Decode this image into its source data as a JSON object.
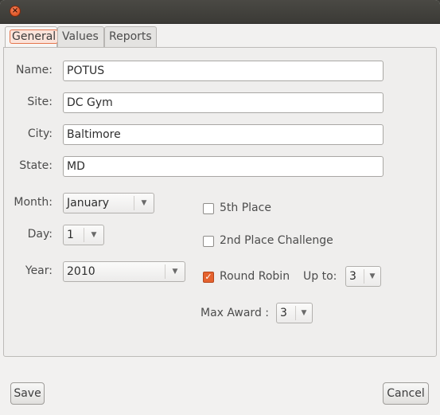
{
  "titlebar": {
    "close_glyph": "×"
  },
  "tabs": [
    {
      "label": "General"
    },
    {
      "label": "Values"
    },
    {
      "label": "Reports"
    }
  ],
  "general": {
    "name": {
      "label": "Name:",
      "value": "POTUS"
    },
    "site": {
      "label": "Site:",
      "value": "DC Gym"
    },
    "city": {
      "label": "City:",
      "value": "Baltimore"
    },
    "state": {
      "label": "State:",
      "value": "MD"
    },
    "month": {
      "label": "Month:",
      "value": "January"
    },
    "day": {
      "label": "Day:",
      "value": "1"
    },
    "year": {
      "label": "Year:",
      "value": "2010"
    },
    "fifth_place": {
      "label": "5th Place",
      "checked": false
    },
    "second_place_challenge": {
      "label": "2nd Place Challenge",
      "checked": false
    },
    "round_robin": {
      "label": "Round Robin",
      "checked": true,
      "check_glyph": "✓"
    },
    "up_to": {
      "label": "Up to:",
      "value": "3"
    },
    "max_award": {
      "label": "Max Award :",
      "value": "3"
    }
  },
  "icons": {
    "dropdown_arrow": "▼"
  },
  "footer": {
    "save_label": "Save",
    "cancel_label": "Cancel"
  }
}
